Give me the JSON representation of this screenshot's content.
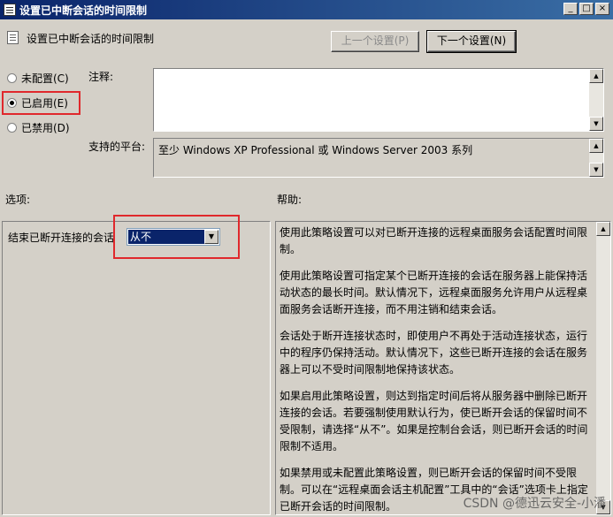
{
  "window": {
    "title": "设置已中断会话的时间限制",
    "minimize": "_",
    "maximize": "□",
    "close": "×"
  },
  "header": {
    "setting_title": "设置已中断会话的时间限制"
  },
  "nav": {
    "prev_label": "上一个设置(P)",
    "next_label": "下一个设置(N)"
  },
  "state": {
    "options": [
      {
        "label": "未配置(C)",
        "checked": false
      },
      {
        "label": "已启用(E)",
        "checked": true
      },
      {
        "label": "已禁用(D)",
        "checked": false
      }
    ]
  },
  "comment": {
    "label": "注释:",
    "value": ""
  },
  "platform": {
    "label": "支持的平台:",
    "value": "至少 Windows XP Professional 或 Windows Server 2003 系列"
  },
  "options_section": {
    "label": "选项:",
    "end_session_label": "结束已断开连接的会话",
    "end_session_value": "从不"
  },
  "help_section": {
    "label": "帮助:",
    "paragraphs": [
      "使用此策略设置可以对已断开连接的远程桌面服务会话配置时间限制。",
      "使用此策略设置可指定某个已断开连接的会话在服务器上能保持活动状态的最长时间。默认情况下，远程桌面服务允许用户从远程桌面服务会话断开连接，而不用注销和结束会话。",
      "会话处于断开连接状态时，即使用户不再处于活动连接状态，运行中的程序仍保持活动。默认情况下，这些已断开连接的会话在服务器上可以不受时间限制地保持该状态。",
      "如果启用此策略设置，则达到指定时间后将从服务器中删除已断开连接的会话。若要强制使用默认行为，使已断开会话的保留时间不受限制，请选择“从不”。如果是控制台会话，则已断开会话的时间限制不适用。",
      "如果禁用或未配置此策略设置，则已断开会话的保留时间不受限制。可以在“远程桌面会话主机配置”工具中的“会话”选项卡上指定已断开会话的时间限制。"
    ]
  },
  "watermark": "CSDN @德迅云安全-小潘",
  "colors": {
    "highlight_red": "#e0282c",
    "title_blue": "#0a246a",
    "selection_blue": "#0a246a"
  }
}
